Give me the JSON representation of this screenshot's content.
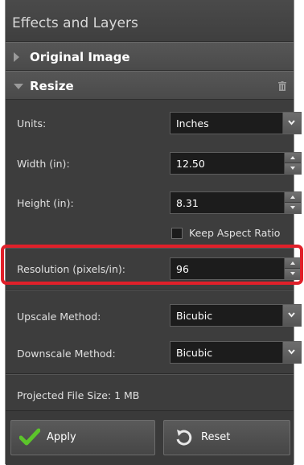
{
  "panel": {
    "title": "Effects and Layers"
  },
  "sections": {
    "original": {
      "label": "Original Image"
    },
    "resize": {
      "label": "Resize"
    }
  },
  "fields": {
    "units": {
      "label": "Units:",
      "value": "Inches"
    },
    "width": {
      "label": "Width (in):",
      "value": "12.50"
    },
    "height": {
      "label": "Height (in):",
      "value": "8.31"
    },
    "keep_aspect": {
      "label": "Keep Aspect Ratio",
      "checked": false
    },
    "resolution": {
      "label": "Resolution (pixels/in):",
      "value": "96"
    },
    "upscale": {
      "label": "Upscale Method:",
      "value": "Bicubic"
    },
    "downscale": {
      "label": "Downscale Method:",
      "value": "Bicubic"
    }
  },
  "projected_size": "Projected File Size: 1 MB",
  "buttons": {
    "apply": "Apply",
    "reset": "Reset"
  },
  "colors": {
    "highlight": "#e0202a",
    "check_green": "#5cc42b",
    "panel_bg": "#3d3d3d"
  }
}
